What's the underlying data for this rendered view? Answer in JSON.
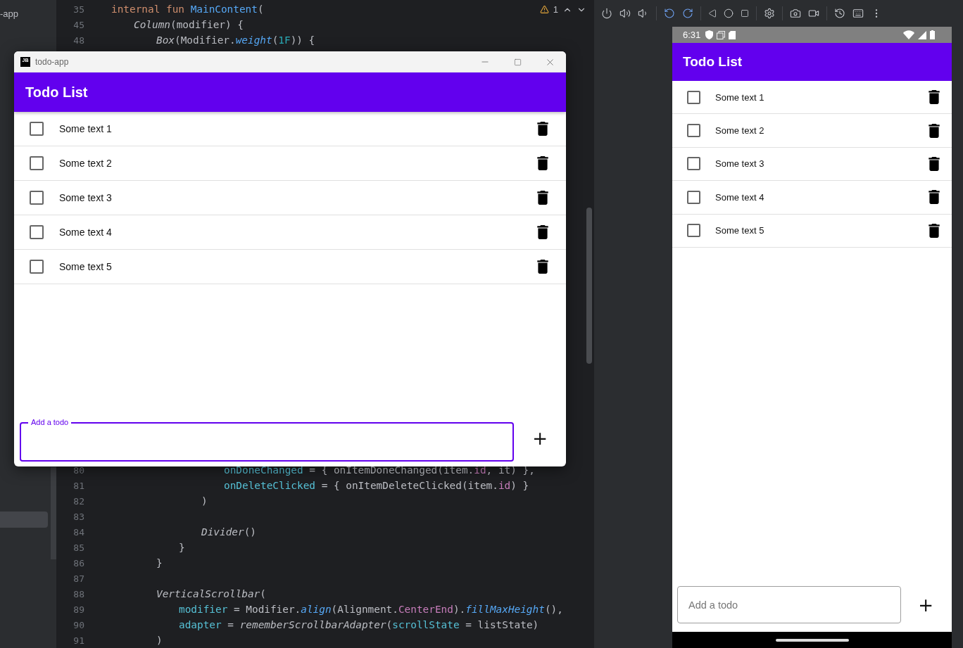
{
  "ide": {
    "project_label": "-app",
    "warning_count": "1",
    "code_top": [
      {
        "number": "35",
        "tokens": [
          {
            "kind": "keyword",
            "text": "internal fun "
          },
          {
            "kind": "function",
            "text": "MainContent"
          },
          {
            "kind": "plain",
            "text": "("
          }
        ]
      },
      {
        "number": "45",
        "tokens": [
          {
            "kind": "italic",
            "text": "Column"
          },
          {
            "kind": "plain",
            "text": "(modifier) {"
          }
        ]
      },
      {
        "number": "48",
        "tokens": [
          {
            "kind": "italic",
            "text": "Box"
          },
          {
            "kind": "plain",
            "text": "(Modifier."
          },
          {
            "kind": "function_italic",
            "text": "weight"
          },
          {
            "kind": "plain",
            "text": "("
          },
          {
            "kind": "number",
            "text": "1F"
          },
          {
            "kind": "plain",
            "text": ")) {"
          }
        ]
      }
    ],
    "code_bottom": [
      {
        "number": "80",
        "tokens": [
          {
            "kind": "param",
            "text": "onDoneChanged"
          },
          {
            "kind": "plain",
            "text": " = { onItemDoneChanged(item."
          },
          {
            "kind": "property",
            "text": "id"
          },
          {
            "kind": "plain",
            "text": ", it) },"
          }
        ]
      },
      {
        "number": "81",
        "tokens": [
          {
            "kind": "param",
            "text": "onDeleteClicked"
          },
          {
            "kind": "plain",
            "text": " = { onItemDeleteClicked(item."
          },
          {
            "kind": "property",
            "text": "id"
          },
          {
            "kind": "plain",
            "text": ") }"
          }
        ]
      },
      {
        "number": "82",
        "tokens": [
          {
            "kind": "plain",
            "text": ")"
          }
        ]
      },
      {
        "number": "83"
      },
      {
        "number": "84",
        "tokens": [
          {
            "kind": "italic",
            "text": "Divider"
          },
          {
            "kind": "plain",
            "text": "()"
          }
        ]
      },
      {
        "number": "85",
        "tokens": [
          {
            "kind": "plain",
            "text": "}"
          }
        ]
      },
      {
        "number": "86",
        "tokens": [
          {
            "kind": "plain",
            "text": "}"
          }
        ]
      },
      {
        "number": "87"
      },
      {
        "number": "88",
        "tokens": [
          {
            "kind": "italic",
            "text": "VerticalScrollbar"
          },
          {
            "kind": "plain",
            "text": "("
          }
        ]
      },
      {
        "number": "89",
        "tokens": [
          {
            "kind": "param",
            "text": "modifier"
          },
          {
            "kind": "plain",
            "text": " = Modifier."
          },
          {
            "kind": "function_italic",
            "text": "align"
          },
          {
            "kind": "plain",
            "text": "(Alignment."
          },
          {
            "kind": "property",
            "text": "CenterEnd"
          },
          {
            "kind": "plain",
            "text": ")."
          },
          {
            "kind": "function_italic",
            "text": "fillMaxHeight"
          },
          {
            "kind": "plain",
            "text": "(),"
          }
        ]
      },
      {
        "number": "90",
        "tokens": [
          {
            "kind": "param",
            "text": "adapter"
          },
          {
            "kind": "plain",
            "text": " = "
          },
          {
            "kind": "italic",
            "text": "rememberScrollbarAdapter"
          },
          {
            "kind": "plain",
            "text": "("
          },
          {
            "kind": "param",
            "text": "scrollState"
          },
          {
            "kind": "plain",
            "text": " = listState)"
          }
        ]
      },
      {
        "number": "91",
        "tokens": [
          {
            "kind": "plain",
            "text": ")"
          }
        ]
      }
    ]
  },
  "desktop_window": {
    "logo_text": "JB",
    "title": "todo-app",
    "app": {
      "title": "Todo List",
      "items": [
        {
          "text": "Some text 1",
          "checked": false
        },
        {
          "text": "Some text 2",
          "checked": false
        },
        {
          "text": "Some text 3",
          "checked": false
        },
        {
          "text": "Some text 4",
          "checked": false
        },
        {
          "text": "Some text 5",
          "checked": false
        }
      ],
      "input": {
        "label": "Add a todo",
        "focused": true
      },
      "add_button": "+"
    }
  },
  "emulator": {
    "status_time": "6:31",
    "app": {
      "title": "Todo List",
      "items": [
        {
          "text": "Some text 1",
          "checked": false
        },
        {
          "text": "Some text 2",
          "checked": false
        },
        {
          "text": "Some text 3",
          "checked": false
        },
        {
          "text": "Some text 4",
          "checked": false
        },
        {
          "text": "Some text 5",
          "checked": false
        }
      ],
      "input": {
        "label": "Add a todo",
        "focused": false
      },
      "add_button": "+"
    }
  }
}
